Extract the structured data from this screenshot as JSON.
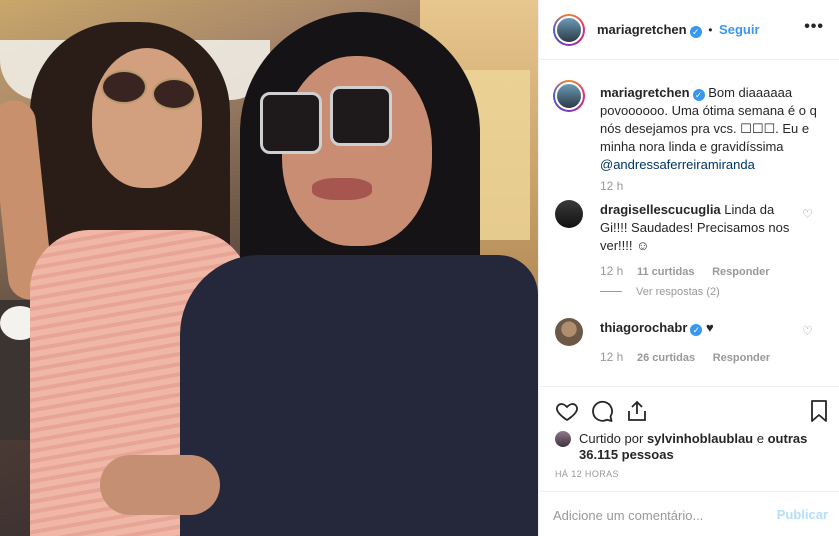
{
  "post": {
    "author": "mariagretchen",
    "follow_separator": "•",
    "follow_label": "Seguir",
    "more_label": "•••"
  },
  "caption": {
    "author": "mariagretchen",
    "text": "Bom diaaaaaa povoooooo. Uma ótima semana é o q nós desejamos pra vcs. ☐☐☐. Eu e minha nora linda e gravidíssima",
    "mention": "@andressaferreiramiranda",
    "time": "12 h"
  },
  "comments": [
    {
      "author": "dragisellescucuglia",
      "text": "Linda da Gi!!!! Saudades! Precisamos nos ver!!!! ☺",
      "time": "12 h",
      "likes": "11 curtidas",
      "reply": "Responder",
      "view_replies": "Ver respostas (2)"
    },
    {
      "author": "thiagorochabr",
      "text": "♥",
      "time": "12 h",
      "likes": "26 curtidas",
      "reply": "Responder"
    }
  ],
  "likes": {
    "prefix": "Curtido por",
    "user": "sylvinhoblaublau",
    "middle": "e",
    "others": "outras 36.115 pessoas"
  },
  "posted_ago": "HÁ 12 HORAS",
  "add_comment": {
    "placeholder": "Adicione um comentário...",
    "publish_label": "Publicar"
  },
  "icons": {
    "like": "heart-outline-icon",
    "comment": "comment-bubble-icon",
    "share": "share-icon",
    "save": "bookmark-icon",
    "verified": "verified-badge-icon"
  },
  "colors": {
    "link": "#3897f0",
    "mention": "#003569",
    "muted": "#999999",
    "publish_disabled": "#b2dffc"
  }
}
